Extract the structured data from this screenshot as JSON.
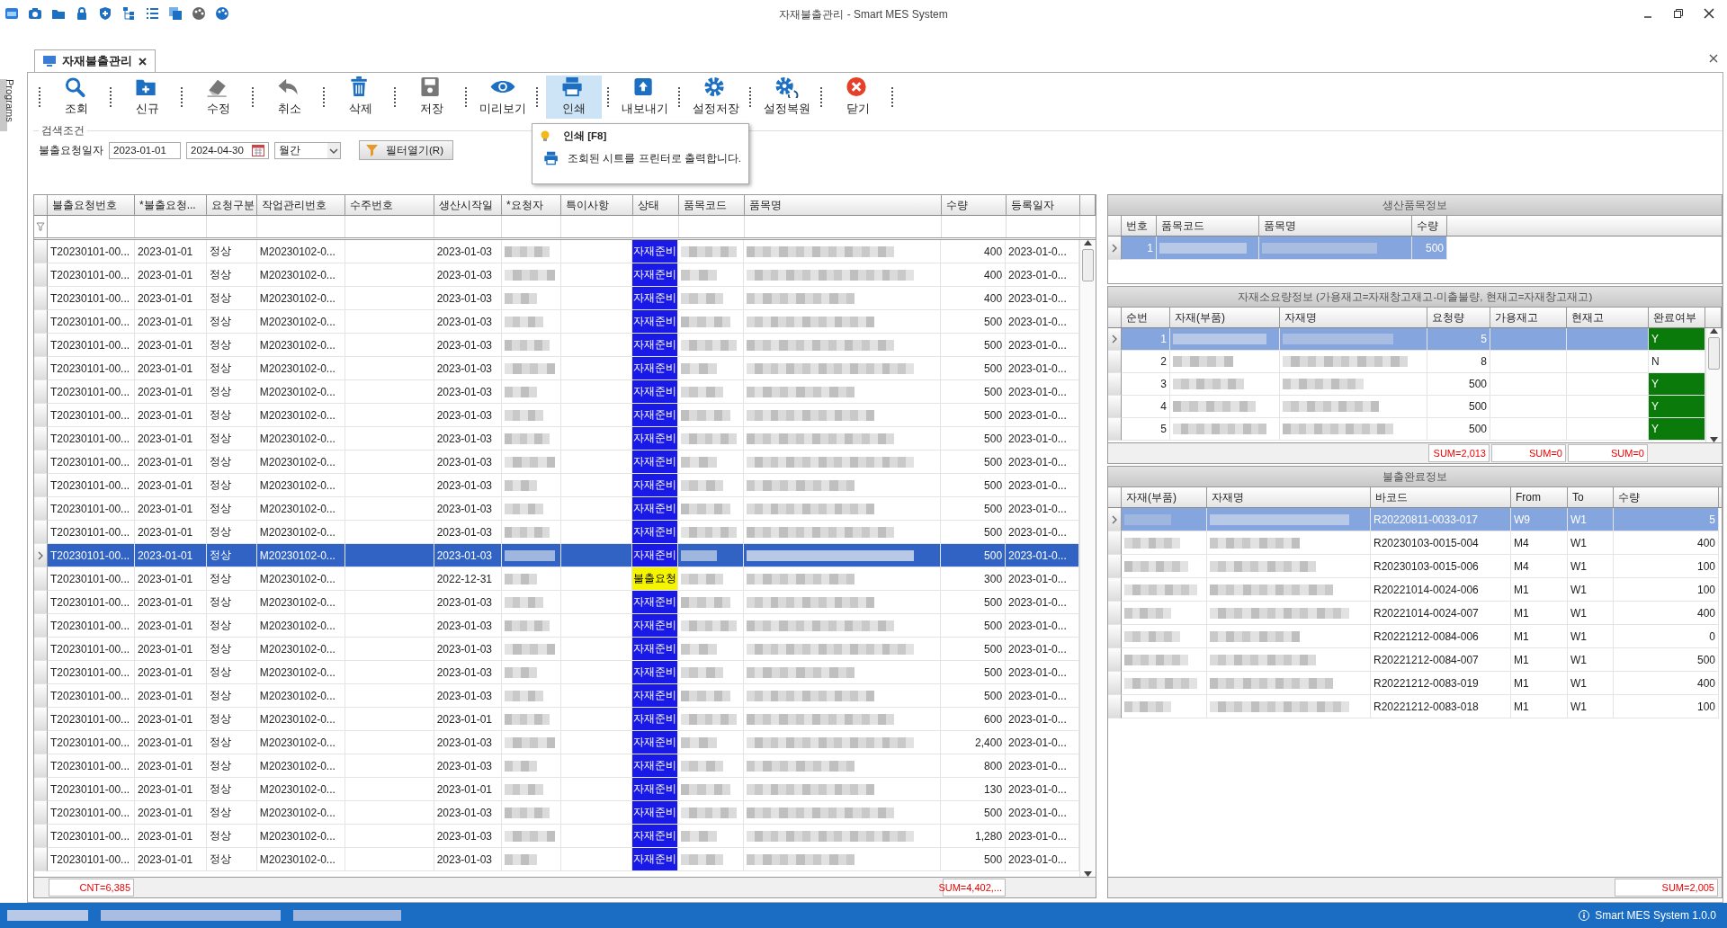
{
  "window": {
    "title": "자재불출관리 - Smart MES System"
  },
  "side_tab": {
    "label": "Programs"
  },
  "document_tab": {
    "label": "자재불출관리"
  },
  "toolbar": {
    "buttons": [
      {
        "label": "조회",
        "hovered": false
      },
      {
        "label": "신규",
        "hovered": false
      },
      {
        "label": "수정",
        "hovered": false
      },
      {
        "label": "취소",
        "hovered": false
      },
      {
        "label": "삭제",
        "hovered": false
      },
      {
        "label": "저장",
        "hovered": false
      },
      {
        "label": "미리보기",
        "hovered": false
      },
      {
        "label": "인쇄",
        "hovered": true
      },
      {
        "label": "내보내기",
        "hovered": false
      },
      {
        "label": "설정저장",
        "hovered": false
      },
      {
        "label": "설정복원",
        "hovered": false
      },
      {
        "label": "닫기",
        "hovered": false
      }
    ]
  },
  "tooltip": {
    "title": "인쇄 [F8]",
    "text": "조회된 시트를 프린터로 출력합니다."
  },
  "search": {
    "group_title": "검색조건",
    "date_label": "불출요청일자",
    "date_from": "2023-01-01",
    "date_to": "2024-04-30",
    "period": "월간",
    "filter_button": "필터열기(R)"
  },
  "main_grid": {
    "columns": [
      {
        "label": "불출요청번호",
        "kind": "text",
        "total": "CNT=6,385"
      },
      {
        "label": "*불출요청...",
        "kind": "text"
      },
      {
        "label": "요청구분",
        "kind": "text"
      },
      {
        "label": "작업관리번호",
        "kind": "text"
      },
      {
        "label": "수주번호",
        "kind": "text"
      },
      {
        "label": "생산시작일",
        "kind": "text"
      },
      {
        "label": "*요청자",
        "kind": "redacted"
      },
      {
        "label": "특이사항",
        "kind": "text"
      },
      {
        "label": "상태",
        "kind": "status"
      },
      {
        "label": "품목코드",
        "kind": "redacted"
      },
      {
        "label": "품목명",
        "kind": "redacted"
      },
      {
        "label": "수량",
        "kind": "number",
        "total": "SUM=4,402,..."
      },
      {
        "label": "등록일자",
        "kind": "text"
      }
    ],
    "rows": [
      {
        "cells": [
          "T20230101-00...",
          "2023-01-01",
          "정상",
          "M20230102-0...",
          null,
          "2023-01-03",
          null,
          null,
          "자재준비",
          null,
          null,
          "400",
          "2023-01-0..."
        ],
        "color": "#1a1ae6",
        "selected": false
      },
      {
        "cells": [
          "T20230101-00...",
          "2023-01-01",
          "정상",
          "M20230102-0...",
          null,
          "2023-01-03",
          null,
          null,
          "자재준비",
          null,
          null,
          "400",
          "2023-01-0..."
        ],
        "color": "#1a1ae6",
        "selected": false
      },
      {
        "cells": [
          "T20230101-00...",
          "2023-01-01",
          "정상",
          "M20230102-0...",
          null,
          "2023-01-03",
          null,
          null,
          "자재준비",
          null,
          null,
          "400",
          "2023-01-0..."
        ],
        "color": "#1a1ae6",
        "selected": false
      },
      {
        "cells": [
          "T20230101-00...",
          "2023-01-01",
          "정상",
          "M20230102-0...",
          null,
          "2023-01-03",
          null,
          null,
          "자재준비",
          null,
          null,
          "500",
          "2023-01-0..."
        ],
        "color": "#1a1ae6",
        "selected": false
      },
      {
        "cells": [
          "T20230101-00...",
          "2023-01-01",
          "정상",
          "M20230102-0...",
          null,
          "2023-01-03",
          null,
          null,
          "자재준비",
          null,
          null,
          "500",
          "2023-01-0..."
        ],
        "color": "#1a1ae6",
        "selected": false
      },
      {
        "cells": [
          "T20230101-00...",
          "2023-01-01",
          "정상",
          "M20230102-0...",
          null,
          "2023-01-03",
          null,
          null,
          "자재준비",
          null,
          null,
          "500",
          "2023-01-0..."
        ],
        "color": "#1a1ae6",
        "selected": false
      },
      {
        "cells": [
          "T20230101-00...",
          "2023-01-01",
          "정상",
          "M20230102-0...",
          null,
          "2023-01-03",
          null,
          null,
          "자재준비",
          null,
          null,
          "500",
          "2023-01-0..."
        ],
        "color": "#1a1ae6",
        "selected": false
      },
      {
        "cells": [
          "T20230101-00...",
          "2023-01-01",
          "정상",
          "M20230102-0...",
          null,
          "2023-01-03",
          null,
          null,
          "자재준비",
          null,
          null,
          "500",
          "2023-01-0..."
        ],
        "color": "#1a1ae6",
        "selected": false
      },
      {
        "cells": [
          "T20230101-00...",
          "2023-01-01",
          "정상",
          "M20230102-0...",
          null,
          "2023-01-03",
          null,
          null,
          "자재준비",
          null,
          null,
          "500",
          "2023-01-0..."
        ],
        "color": "#1a1ae6",
        "selected": false
      },
      {
        "cells": [
          "T20230101-00...",
          "2023-01-01",
          "정상",
          "M20230102-0...",
          null,
          "2023-01-03",
          null,
          null,
          "자재준비",
          null,
          null,
          "500",
          "2023-01-0..."
        ],
        "color": "#1a1ae6",
        "selected": false
      },
      {
        "cells": [
          "T20230101-00...",
          "2023-01-01",
          "정상",
          "M20230102-0...",
          null,
          "2023-01-03",
          null,
          null,
          "자재준비",
          null,
          null,
          "500",
          "2023-01-0..."
        ],
        "color": "#1a1ae6",
        "selected": false
      },
      {
        "cells": [
          "T20230101-00...",
          "2023-01-01",
          "정상",
          "M20230102-0...",
          null,
          "2023-01-03",
          null,
          null,
          "자재준비",
          null,
          null,
          "500",
          "2023-01-0..."
        ],
        "color": "#1a1ae6",
        "selected": false
      },
      {
        "cells": [
          "T20230101-00...",
          "2023-01-01",
          "정상",
          "M20230102-0...",
          null,
          "2023-01-03",
          null,
          null,
          "자재준비",
          null,
          null,
          "500",
          "2023-01-0..."
        ],
        "color": "#1a1ae6",
        "selected": false
      },
      {
        "cells": [
          "T20230101-00...",
          "2023-01-01",
          "정상",
          "M20230102-0...",
          null,
          "2023-01-03",
          null,
          null,
          "자재준비",
          null,
          null,
          "500",
          "2023-01-0..."
        ],
        "color": "#1a1ae6",
        "selected": true
      },
      {
        "cells": [
          "T20230101-00...",
          "2023-01-01",
          "정상",
          "M20230102-0...",
          null,
          "2022-12-31",
          null,
          null,
          "불출요청",
          null,
          null,
          "300",
          "2023-01-0..."
        ],
        "color": "#f5f500",
        "selected": false
      },
      {
        "cells": [
          "T20230101-00...",
          "2023-01-01",
          "정상",
          "M20230102-0...",
          null,
          "2023-01-03",
          null,
          null,
          "자재준비",
          null,
          null,
          "500",
          "2023-01-0..."
        ],
        "color": "#1a1ae6",
        "selected": false
      },
      {
        "cells": [
          "T20230101-00...",
          "2023-01-01",
          "정상",
          "M20230102-0...",
          null,
          "2023-01-03",
          null,
          null,
          "자재준비",
          null,
          null,
          "500",
          "2023-01-0..."
        ],
        "color": "#1a1ae6",
        "selected": false
      },
      {
        "cells": [
          "T20230101-00...",
          "2023-01-01",
          "정상",
          "M20230102-0...",
          null,
          "2023-01-03",
          null,
          null,
          "자재준비",
          null,
          null,
          "500",
          "2023-01-0..."
        ],
        "color": "#1a1ae6",
        "selected": false
      },
      {
        "cells": [
          "T20230101-00...",
          "2023-01-01",
          "정상",
          "M20230102-0...",
          null,
          "2023-01-03",
          null,
          null,
          "자재준비",
          null,
          null,
          "500",
          "2023-01-0..."
        ],
        "color": "#1a1ae6",
        "selected": false
      },
      {
        "cells": [
          "T20230101-00...",
          "2023-01-01",
          "정상",
          "M20230102-0...",
          null,
          "2023-01-03",
          null,
          null,
          "자재준비",
          null,
          null,
          "500",
          "2023-01-0..."
        ],
        "color": "#1a1ae6",
        "selected": false
      },
      {
        "cells": [
          "T20230101-00...",
          "2023-01-01",
          "정상",
          "M20230102-0...",
          null,
          "2023-01-01",
          null,
          null,
          "자재준비",
          null,
          null,
          "600",
          "2023-01-0..."
        ],
        "color": "#1a1ae6",
        "selected": false
      },
      {
        "cells": [
          "T20230101-00...",
          "2023-01-01",
          "정상",
          "M20230102-0...",
          null,
          "2023-01-03",
          null,
          null,
          "자재준비",
          null,
          null,
          "2,400",
          "2023-01-0..."
        ],
        "color": "#1a1ae6",
        "selected": false
      },
      {
        "cells": [
          "T20230101-00...",
          "2023-01-01",
          "정상",
          "M20230102-0...",
          null,
          "2023-01-03",
          null,
          null,
          "자재준비",
          null,
          null,
          "800",
          "2023-01-0..."
        ],
        "color": "#1a1ae6",
        "selected": false
      },
      {
        "cells": [
          "T20230101-00...",
          "2023-01-01",
          "정상",
          "M20230102-0...",
          null,
          "2023-01-01",
          null,
          null,
          "자재준비",
          null,
          null,
          "130",
          "2023-01-0..."
        ],
        "color": "#1a1ae6",
        "selected": false
      },
      {
        "cells": [
          "T20230101-00...",
          "2023-01-01",
          "정상",
          "M20230102-0...",
          null,
          "2023-01-03",
          null,
          null,
          "자재준비",
          null,
          null,
          "500",
          "2023-01-0..."
        ],
        "color": "#1a1ae6",
        "selected": false
      },
      {
        "cells": [
          "T20230101-00...",
          "2023-01-01",
          "정상",
          "M20230102-0...",
          null,
          "2023-01-03",
          null,
          null,
          "자재준비",
          null,
          null,
          "1,280",
          "2023-01-0..."
        ],
        "color": "#1a1ae6",
        "selected": false
      },
      {
        "cells": [
          "T20230101-00...",
          "2023-01-01",
          "정상",
          "M20230102-0...",
          null,
          "2023-01-03",
          null,
          null,
          "자재준비",
          null,
          null,
          "500",
          "2023-01-0..."
        ],
        "color": "#1a1ae6",
        "selected": false
      }
    ]
  },
  "product_panel": {
    "title": "생산품목정보",
    "columns": [
      {
        "label": "번호",
        "kind": "number"
      },
      {
        "label": "품목코드",
        "kind": "redacted"
      },
      {
        "label": "품목명",
        "kind": "redacted"
      },
      {
        "label": "수량",
        "kind": "number"
      }
    ],
    "rows": [
      {
        "cells": [
          "1",
          null,
          null,
          "500"
        ],
        "selected": true
      }
    ]
  },
  "material_panel": {
    "title": "자재소요량정보 (가용재고=자재창고재고-미출불량, 현재고=자재창고재고)",
    "columns": [
      {
        "label": "순번",
        "kind": "number"
      },
      {
        "label": "자재(부품)",
        "kind": "redacted"
      },
      {
        "label": "자재명",
        "kind": "redacted"
      },
      {
        "label": "요청량",
        "kind": "number",
        "total": "SUM=2,013"
      },
      {
        "label": "가용재고",
        "kind": "number",
        "total": "SUM=0"
      },
      {
        "label": "현재고",
        "kind": "number",
        "total": "SUM=0"
      },
      {
        "label": "완료여부",
        "kind": "flag"
      }
    ],
    "rows": [
      {
        "cells": [
          "1",
          null,
          null,
          "5",
          null,
          null,
          "Y"
        ],
        "complete": true,
        "selected": true
      },
      {
        "cells": [
          "2",
          null,
          null,
          "8",
          null,
          null,
          "N"
        ],
        "complete": false,
        "selected": false
      },
      {
        "cells": [
          "3",
          null,
          null,
          "500",
          null,
          null,
          "Y"
        ],
        "complete": true,
        "selected": false
      },
      {
        "cells": [
          "4",
          null,
          null,
          "500",
          null,
          null,
          "Y"
        ],
        "complete": true,
        "selected": false
      },
      {
        "cells": [
          "5",
          null,
          null,
          "500",
          null,
          null,
          "Y"
        ],
        "complete": true,
        "selected": false
      }
    ]
  },
  "issued_panel": {
    "title": "불출완료정보",
    "columns": [
      {
        "label": "자재(부품)",
        "kind": "redacted"
      },
      {
        "label": "자재명",
        "kind": "redacted"
      },
      {
        "label": "바코드",
        "kind": "text"
      },
      {
        "label": "From",
        "kind": "text"
      },
      {
        "label": "To",
        "kind": "text"
      },
      {
        "label": "수량",
        "kind": "number",
        "total": "SUM=2,005"
      }
    ],
    "rows": [
      {
        "cells": [
          null,
          null,
          "R20220811-0033-017",
          "W9",
          "W1",
          "5"
        ],
        "selected": true
      },
      {
        "cells": [
          null,
          null,
          "R20230103-0015-004",
          "M4",
          "W1",
          "400"
        ],
        "selected": false
      },
      {
        "cells": [
          null,
          null,
          "R20230103-0015-006",
          "M4",
          "W1",
          "100"
        ],
        "selected": false
      },
      {
        "cells": [
          null,
          null,
          "R20221014-0024-006",
          "M1",
          "W1",
          "100"
        ],
        "selected": false
      },
      {
        "cells": [
          null,
          null,
          "R20221014-0024-007",
          "M1",
          "W1",
          "400"
        ],
        "selected": false
      },
      {
        "cells": [
          null,
          null,
          "R20221212-0084-006",
          "M1",
          "W1",
          "0"
        ],
        "selected": false
      },
      {
        "cells": [
          null,
          null,
          "R20221212-0084-007",
          "M1",
          "W1",
          "500"
        ],
        "selected": false
      },
      {
        "cells": [
          null,
          null,
          "R20221212-0083-019",
          "M1",
          "W1",
          "400"
        ],
        "selected": false
      },
      {
        "cells": [
          null,
          null,
          "R20221212-0083-018",
          "M1",
          "W1",
          "100"
        ],
        "selected": false
      }
    ]
  },
  "status_bar": {
    "version": "Smart MES System 1.0.0"
  }
}
